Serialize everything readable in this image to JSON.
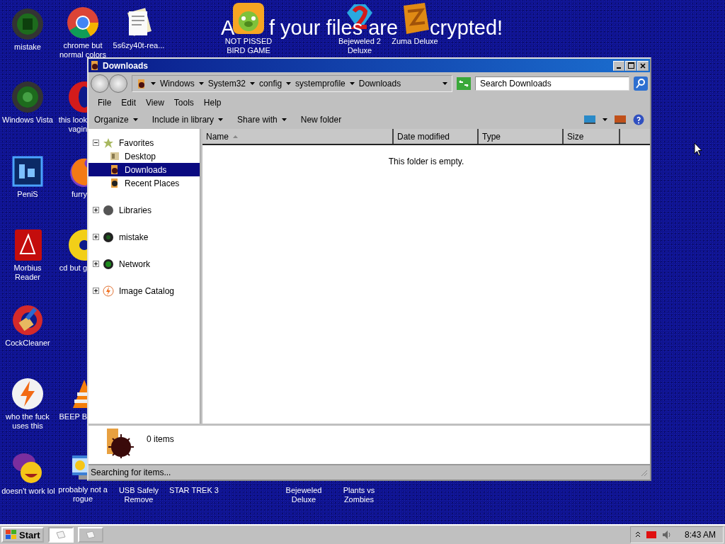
{
  "desktop": {
    "banner": [
      "A",
      "f your files are",
      "crypted!"
    ],
    "icons": [
      {
        "label": "mistake"
      },
      {
        "label": "Windows Vista"
      },
      {
        "label": "PeniS"
      },
      {
        "label": "Morbius\nReader"
      },
      {
        "label": "CockCleaner"
      },
      {
        "label": "who the fuck\nuses this"
      },
      {
        "label": "doesn't work lol"
      },
      {
        "label": "chrome but\nnormal colors"
      },
      {
        "label": "this look\nvagin"
      },
      {
        "label": "furry"
      },
      {
        "label": "cd but g"
      },
      {
        "label": "BEEP B"
      },
      {
        "label": "probably not a\nrogue"
      },
      {
        "label": "5s6zy40t-rea..."
      },
      {
        "label": "NOT PISSED\nBIRD GAME"
      },
      {
        "label": "Bejeweled 2\nDeluxe"
      },
      {
        "label": "Zuma Deluxe"
      },
      {
        "label": "USB Safely\nRemove"
      },
      {
        "label": "STAR TREK 3"
      },
      {
        "label": "Bejeweled\nDeluxe"
      },
      {
        "label": "Plants vs\nZombies"
      }
    ]
  },
  "window": {
    "title": "Downloads",
    "breadcrumb": [
      "Windows",
      "System32",
      "config",
      "systemprofile",
      "Downloads"
    ],
    "search": {
      "placeholder": "Search Downloads"
    },
    "menu": [
      "File",
      "Edit",
      "View",
      "Tools",
      "Help"
    ],
    "toolbar": [
      {
        "label": "Organize",
        "dropdown": true
      },
      {
        "label": "Include in library",
        "dropdown": true
      },
      {
        "label": "Share with",
        "dropdown": true
      },
      {
        "label": "New folder",
        "dropdown": false
      }
    ],
    "nav": [
      {
        "label": "Favorites",
        "expanded": true,
        "selected": false,
        "children": [
          {
            "label": "Desktop",
            "selected": false
          },
          {
            "label": "Downloads",
            "selected": true
          },
          {
            "label": "Recent Places",
            "selected": false
          }
        ]
      },
      {
        "label": "Libraries",
        "expanded": false,
        "selected": false
      },
      {
        "label": "mistake",
        "expanded": false,
        "selected": false
      },
      {
        "label": "Network",
        "expanded": false,
        "selected": false
      },
      {
        "label": "Image Catalog",
        "expanded": false,
        "selected": false
      }
    ],
    "columns": [
      {
        "label": "Name",
        "sorted": true
      },
      {
        "label": "Date modified",
        "sorted": false
      },
      {
        "label": "Type",
        "sorted": false
      },
      {
        "label": "Size",
        "sorted": false
      }
    ],
    "empty_message": "This folder is empty.",
    "details": "0 items",
    "status_bar": "Searching for items..."
  },
  "taskbar": {
    "start": "Start",
    "tasks": [
      {
        "selected": true
      },
      {
        "selected": false
      }
    ],
    "clock": "8:43 AM"
  }
}
